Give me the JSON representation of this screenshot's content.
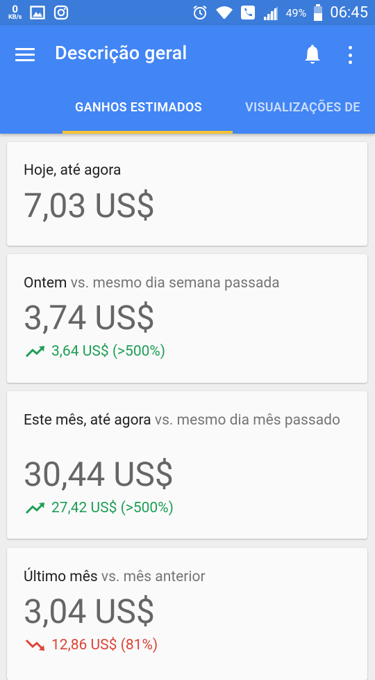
{
  "status_bar": {
    "speed_value": "0",
    "speed_unit": "KB/s",
    "battery": "49%",
    "time": "06:45"
  },
  "app_bar": {
    "title": "Descrição geral",
    "tabs": [
      {
        "label": "GANHOS ESTIMADOS",
        "active": true
      },
      {
        "label": "VISUALIZAÇÕES DE",
        "active": false
      }
    ]
  },
  "cards": [
    {
      "label": "Hoje, até agora",
      "comparison": "",
      "amount": "7,03 US$"
    },
    {
      "label": "Ontem",
      "comparison": "vs. mesmo dia semana passada",
      "amount": "3,74 US$",
      "change": "3,64 US$ (>500%)",
      "trend": "up"
    },
    {
      "label": "Este mês, até agora",
      "comparison": "vs. mesmo dia mês passado",
      "amount": "30,44 US$",
      "change": "27,42 US$ (>500%)",
      "trend": "up"
    },
    {
      "label": "Último mês",
      "comparison": "vs. mês anterior",
      "amount": "3,04 US$",
      "change": "12,86 US$ (81%)",
      "trend": "down"
    }
  ],
  "colors": {
    "app_bar": "#4285f4",
    "status_bar": "#3b7bd9",
    "tab_indicator": "#f4c430",
    "trend_up": "#1e9e55",
    "trend_down": "#db4437"
  },
  "icons": [
    "image-icon",
    "instagram-icon",
    "alarm-icon",
    "wifi-icon",
    "phone-icon",
    "signal-icon",
    "battery-icon",
    "menu-icon",
    "bell-icon",
    "more-vert-icon",
    "trending-up-icon",
    "trending-down-icon"
  ]
}
